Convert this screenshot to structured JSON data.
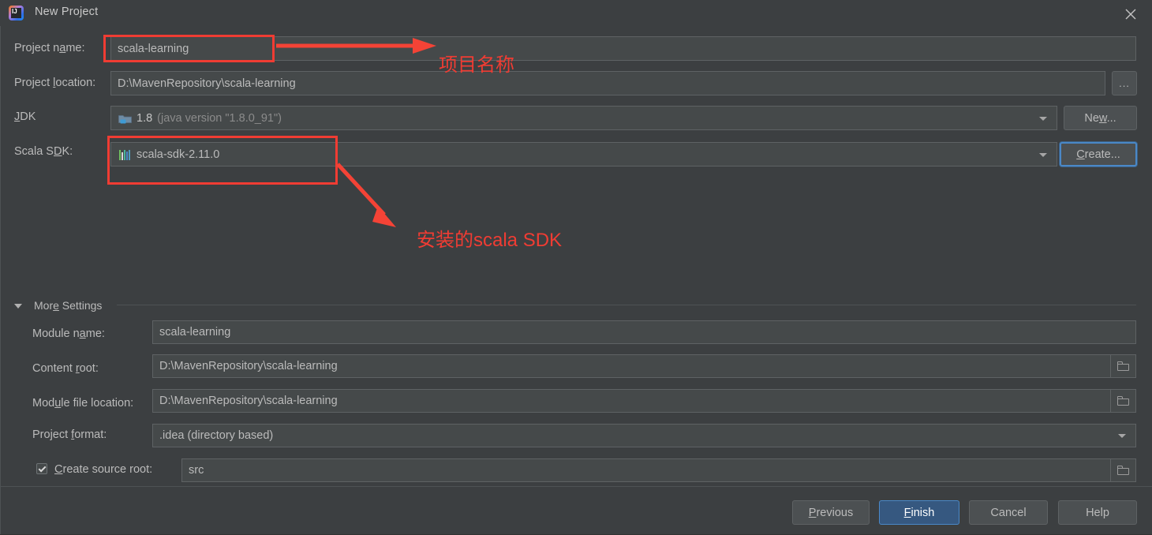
{
  "window": {
    "title": "New Project",
    "app_icon": "intellij-idea-icon",
    "close_icon": "close-icon"
  },
  "form": {
    "project_name": {
      "label": "Project name:",
      "value": "scala-learning"
    },
    "project_location": {
      "label": "Project location:",
      "value": "D:\\MavenRepository\\scala-learning",
      "browse_label": "..."
    },
    "jdk": {
      "label": "JDK",
      "value_main": "1.8",
      "value_detail": "(java version \"1.8.0_91\")",
      "icon": "jdk-folder-icon",
      "new_button": "New..."
    },
    "scala_sdk": {
      "label": "Scala SDK:",
      "value": "scala-sdk-2.11.0",
      "icon": "scala-library-icon",
      "create_button": "Create..."
    }
  },
  "more_settings": {
    "title": "More Settings",
    "expanded": true,
    "module_name": {
      "label": "Module name:",
      "value": "scala-learning"
    },
    "content_root": {
      "label": "Content root:",
      "value": "D:\\MavenRepository\\scala-learning",
      "browse_icon": "folder-icon"
    },
    "module_file_location": {
      "label": "Module file location:",
      "value": "D:\\MavenRepository\\scala-learning",
      "browse_icon": "folder-icon"
    },
    "project_format": {
      "label": "Project format:",
      "value": ".idea (directory based)"
    },
    "create_source_root": {
      "label": "Create source root:",
      "checked": true,
      "value": "src",
      "browse_icon": "folder-icon"
    }
  },
  "footer": {
    "previous": "Previous",
    "finish": "Finish",
    "cancel": "Cancel",
    "help": "Help"
  },
  "annotations": {
    "project_name_note": "项目名称",
    "scala_sdk_note": "安装的scala SDK",
    "color": "#f03c33"
  }
}
